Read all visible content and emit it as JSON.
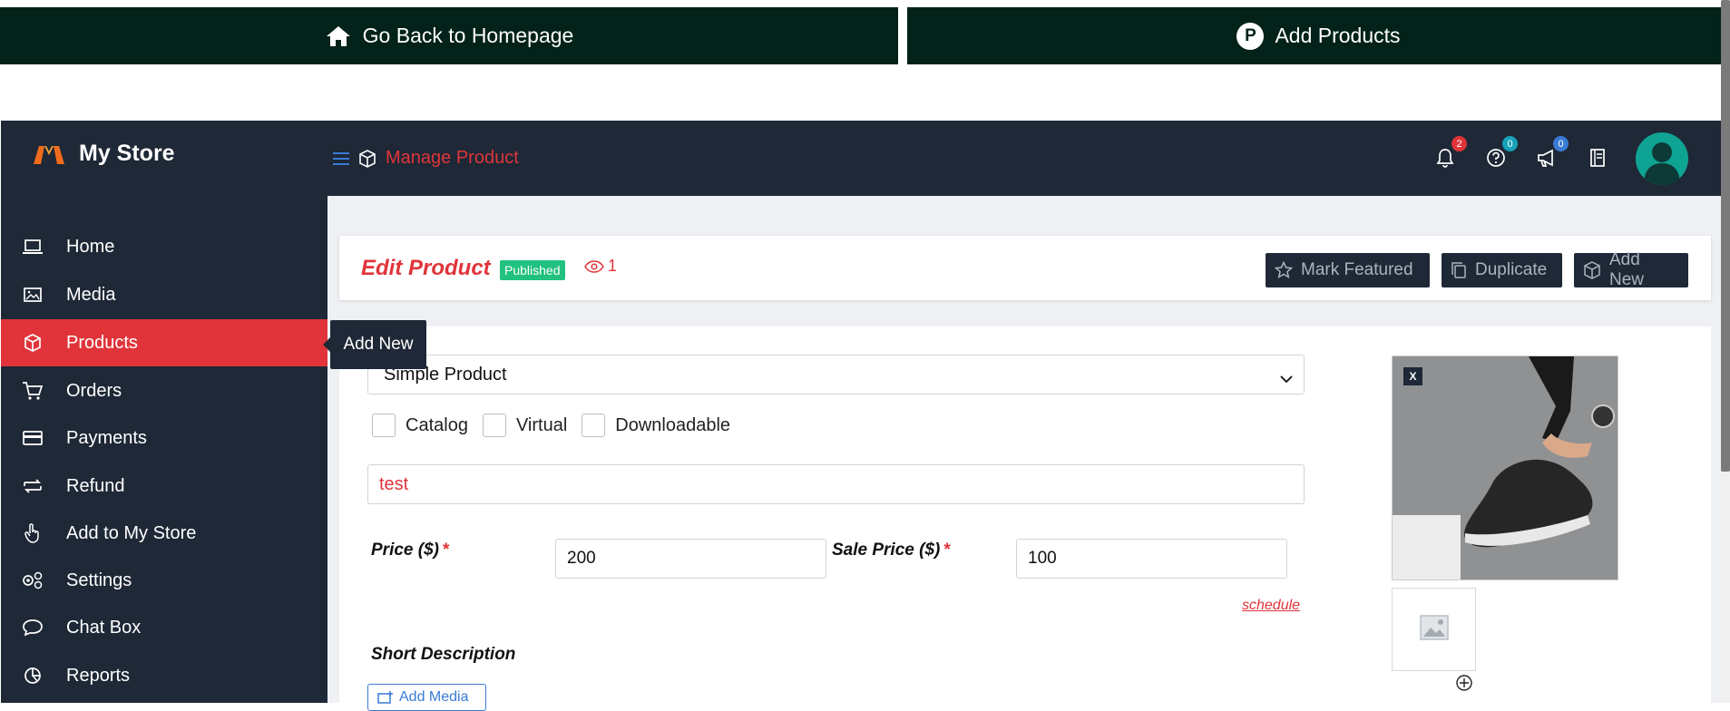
{
  "top_bar": {
    "home_label": "Go Back to Homepage",
    "add_products_label": "Add Products",
    "add_products_icon_letter": "P"
  },
  "header": {
    "brand": "My Store",
    "page_title": "Manage Product",
    "notifications_count": "2",
    "help_count": "0",
    "announcements_count": "0",
    "colors": {
      "accent": "#e0343a",
      "dark": "#1e2836",
      "notif_badge": "#e0343a",
      "help_badge": "#17a2b8",
      "announce_badge": "#3a7bd5"
    }
  },
  "sidebar": {
    "items": [
      {
        "label": "Home",
        "icon": "laptop-icon"
      },
      {
        "label": "Media",
        "icon": "image-icon"
      },
      {
        "label": "Products",
        "icon": "box-icon",
        "active": true
      },
      {
        "label": "Orders",
        "icon": "cart-icon"
      },
      {
        "label": "Payments",
        "icon": "credit-card-icon"
      },
      {
        "label": "Refund",
        "icon": "refund-arrows-icon"
      },
      {
        "label": "Add to My Store",
        "icon": "hand-pointer-icon"
      },
      {
        "label": "Settings",
        "icon": "gears-icon"
      },
      {
        "label": "Chat Box",
        "icon": "chat-icon"
      },
      {
        "label": "Reports",
        "icon": "pie-chart-icon"
      }
    ]
  },
  "tooltip": {
    "text": "Add New"
  },
  "edit_header": {
    "title": "Edit Product",
    "status": "Published",
    "views": "1",
    "mark_featured_label": "Mark Featured",
    "duplicate_label": "Duplicate",
    "add_new_label": "Add New"
  },
  "form": {
    "product_type": "Simple Product",
    "checkboxes": [
      "Catalog",
      "Virtual",
      "Downloadable"
    ],
    "product_title": "test",
    "price_label": "Price ($)",
    "price_value": "200",
    "sale_price_label": "Sale Price ($)",
    "sale_price_value": "100",
    "required_mark": "*",
    "schedule_link": "schedule",
    "short_description_label": "Short Description",
    "add_media_label": "Add Media"
  },
  "image": {
    "close_label": "X"
  }
}
